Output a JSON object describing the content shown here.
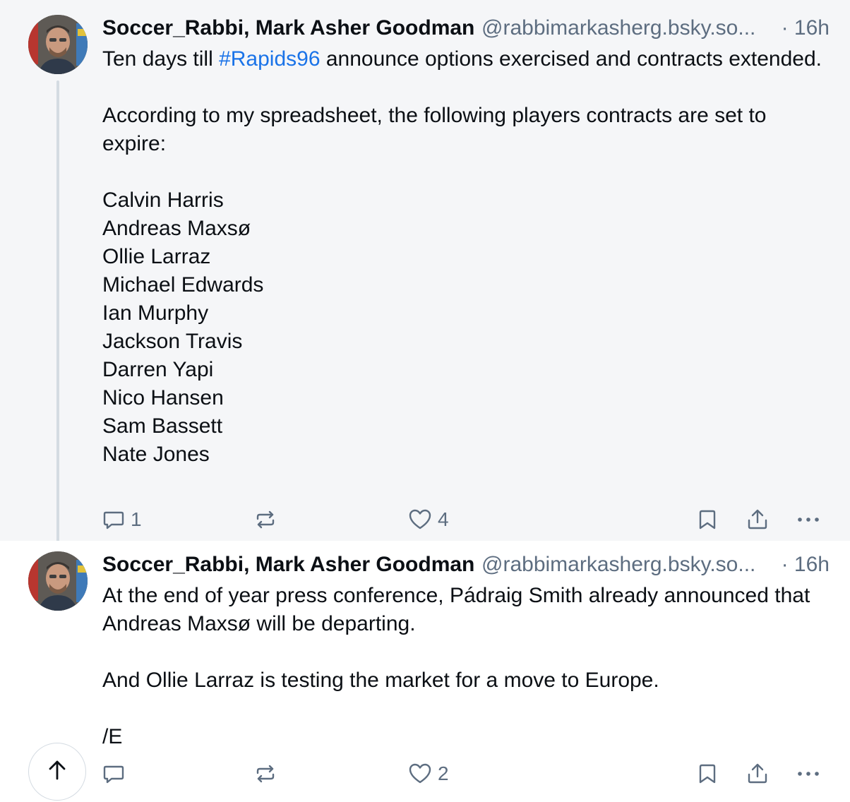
{
  "posts": [
    {
      "author_name": "Soccer_Rabbi, Mark Asher Goodman",
      "author_handle": "@rabbimarkasherg.bsky.so...",
      "time": "· 16h",
      "text_before_tag": "Ten days till ",
      "hashtag": "#Rapids96",
      "text_after_tag": " announce options exercised and contracts extended.",
      "paragraph_2": "According to my spreadsheet, the following players contracts are set to expire:",
      "players": [
        "Calvin Harris",
        "Andreas Maxsø",
        "Ollie Larraz",
        "Michael Edwards",
        "Ian Murphy",
        "Jackson Travis",
        "Darren Yapi",
        "Nico Hansen",
        "Sam Bassett",
        "Nate Jones"
      ],
      "reply_count": "1",
      "repost_count": "",
      "like_count": "4"
    },
    {
      "author_name": "Soccer_Rabbi, Mark Asher Goodman",
      "author_handle": "@rabbimarkasherg.bsky.so...",
      "time": "· 16h",
      "paragraph_1": "At the end of year press conference, Pádraig Smith already announced that Andreas Maxsø will be departing.",
      "paragraph_2": "And Ollie Larraz is testing the market for a move to Europe.",
      "paragraph_3": "/E",
      "reply_count": "",
      "repost_count": "",
      "like_count": "2"
    }
  ],
  "icons": {
    "reply": "speech-bubble-icon",
    "repost": "repost-arrows-icon",
    "like": "heart-icon",
    "bookmark": "bookmark-icon",
    "share": "share-icon",
    "more": "ellipsis-icon",
    "scroll_top": "arrow-up-icon"
  },
  "colors": {
    "hashtag": "#1a73e8",
    "secondary_text": "#5d6d80",
    "highlight_bg": "#f5f6f8"
  }
}
